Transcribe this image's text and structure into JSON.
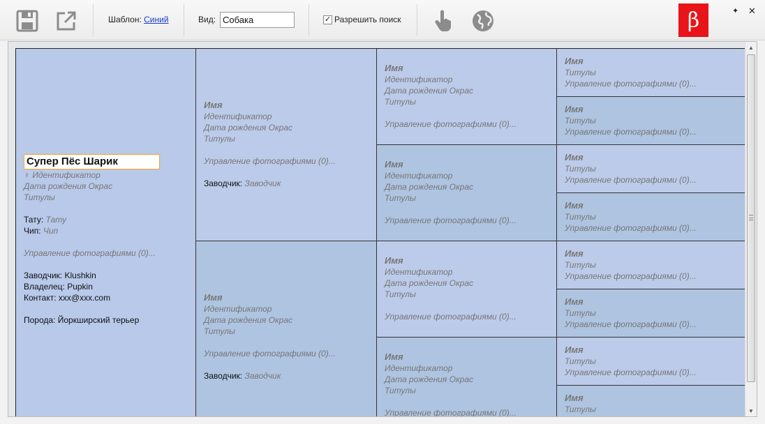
{
  "toolbar": {
    "template_label": "Шаблон:",
    "template_value": "Синий",
    "kind_label": "Вид:",
    "kind_value": "Собака",
    "allow_search_label": "Разрешить поиск",
    "allow_search_checked": "✓",
    "beta_badge": "β",
    "pin_glyph": "✦",
    "close_glyph": "✕",
    "icons": [
      "save-icon",
      "export-icon",
      "hand-pointer-icon",
      "globe-icon",
      "pin-icon",
      "close-icon"
    ]
  },
  "colors": {
    "cell_light": "#bccbe9",
    "cell_dark": "#aec4e1",
    "beta_red": "#e8141a",
    "link": "#1a3cc4"
  },
  "root": {
    "name": "Супер Пёс Шарик",
    "gender_symbol": "♀",
    "id": "Идентификатор",
    "dob_color": "Дата рождения Окрас",
    "titles": "Титулы",
    "tattoo_label": "Тату:",
    "tattoo_value": "Тату",
    "chip_label": "Чип:",
    "chip_value": "Чип",
    "photos": "Управление фотографиями (0)...",
    "breeder_label": "Заводчик:",
    "breeder_value": "Klushkin",
    "owner_label": "Владелец:",
    "owner_value": "Pupkin",
    "contact_label": "Контакт:",
    "contact_value": "xxx@xxx.com",
    "breed_label": "Порода:",
    "breed_value": "Йоркширский терьер"
  },
  "placeholder": {
    "name": "Имя",
    "id": "Идентификатор",
    "dob_color": "Дата рождения Окрас",
    "titles": "Титулы",
    "photos": "Управление фотографиями (0)...",
    "breeder_label": "Заводчик:",
    "breeder_value": "Заводчик"
  }
}
